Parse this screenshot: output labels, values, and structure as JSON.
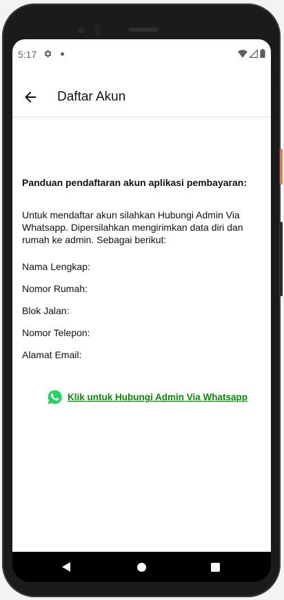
{
  "status_bar": {
    "time": "5:17",
    "icons": [
      "settings-icon",
      "notification-dot-icon",
      "wifi-icon",
      "signal-icon",
      "battery-icon"
    ]
  },
  "app_bar": {
    "back_icon": "arrow-back-icon",
    "title": "Daftar Akun"
  },
  "content": {
    "heading": "Panduan pendaftaran akun aplikasi pembayaran:",
    "description": "Untuk mendaftar akun silahkan Hubungi Admin Via Whatsapp. Dipersilahkan mengirimkan data diri dan rumah ke admin. Sebagai berikut:",
    "fields": [
      "Nama Lengkap:",
      "Nomor Rumah:",
      "Blok Jalan:",
      "Nomor Telepon:",
      "Alamat Email:"
    ],
    "whatsapp_link": {
      "icon": "whatsapp-icon",
      "label": "Klik untuk Hubungi Admin Via Whatsapp",
      "color": "#0a8a0a"
    }
  },
  "nav_bar": {
    "icons": [
      "nav-back-icon",
      "nav-home-icon",
      "nav-recents-icon"
    ]
  }
}
